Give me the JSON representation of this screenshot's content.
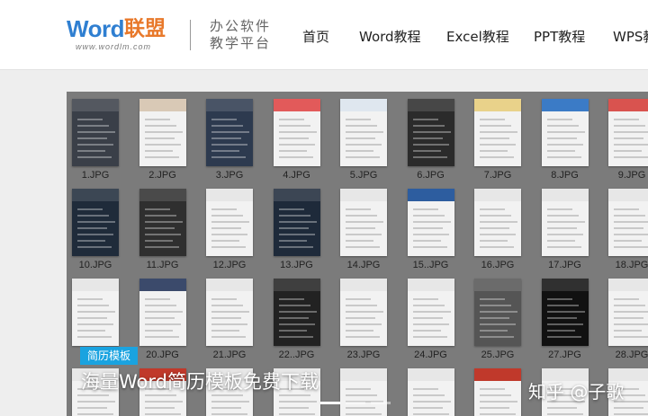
{
  "header": {
    "logo": {
      "word": "Word",
      "cn": "联盟",
      "url": "www.wordlm.com"
    },
    "slogan": [
      "办公软件",
      "教学平台"
    ],
    "nav": [
      "首页",
      "Word教程",
      "Excel教程",
      "PPT教程",
      "WPS教程"
    ]
  },
  "banner": {
    "badge": "简历模板",
    "title": "海量Word简历模板免费下载",
    "watermark": "知乎 @子歌",
    "thumbnails": [
      "1.JPG",
      "2.JPG",
      "3.JPG",
      "4.JPG",
      "5.JPG",
      "6.JPG",
      "7.JPG",
      "8.JPG",
      "9.JPG",
      "10.JPG",
      "11.JPG",
      "12.JPG",
      "13.JPG",
      "14.JPG",
      "15..JPG",
      "16.JPG",
      "17.JPG",
      "18.JPG",
      "",
      "20.JPG",
      "21.JPG",
      "22..JPG",
      "23.JPG",
      "24.JPG",
      "25.JPG",
      "27.JPG",
      "28.JPG",
      "",
      "",
      "",
      "",
      "",
      "",
      "",
      "",
      ""
    ],
    "thumb_colors": [
      "#3a3f48",
      "#d9c9b6",
      "#2d3a4f",
      "#e25a5a",
      "#dfe7ef",
      "#2b2b2b",
      "#e9d28a",
      "#3b7bc6",
      "#d9534f",
      "#1f2b3a",
      "#2f2f2f",
      "#e7e7e7",
      "#1e2a3a",
      "#e7e7e7",
      "#2d5d9f",
      "#e7e7e7",
      "#e7e7e7",
      "#e7e7e7",
      "#e7e7e7",
      "#3b4a6b",
      "#e7e7e7",
      "#222222",
      "#e7e7e7",
      "#e7e7e7",
      "#555555",
      "#111111",
      "#e7e7e7",
      "#e7e7e7",
      "#c0392b",
      "#e7e7e7",
      "#e7e7e7",
      "#e7e7e7",
      "#e7e7e7",
      "#c0392b",
      "#e7e7e7",
      "#e7e7e7"
    ],
    "slide_count": 3,
    "active_slide": 0
  }
}
